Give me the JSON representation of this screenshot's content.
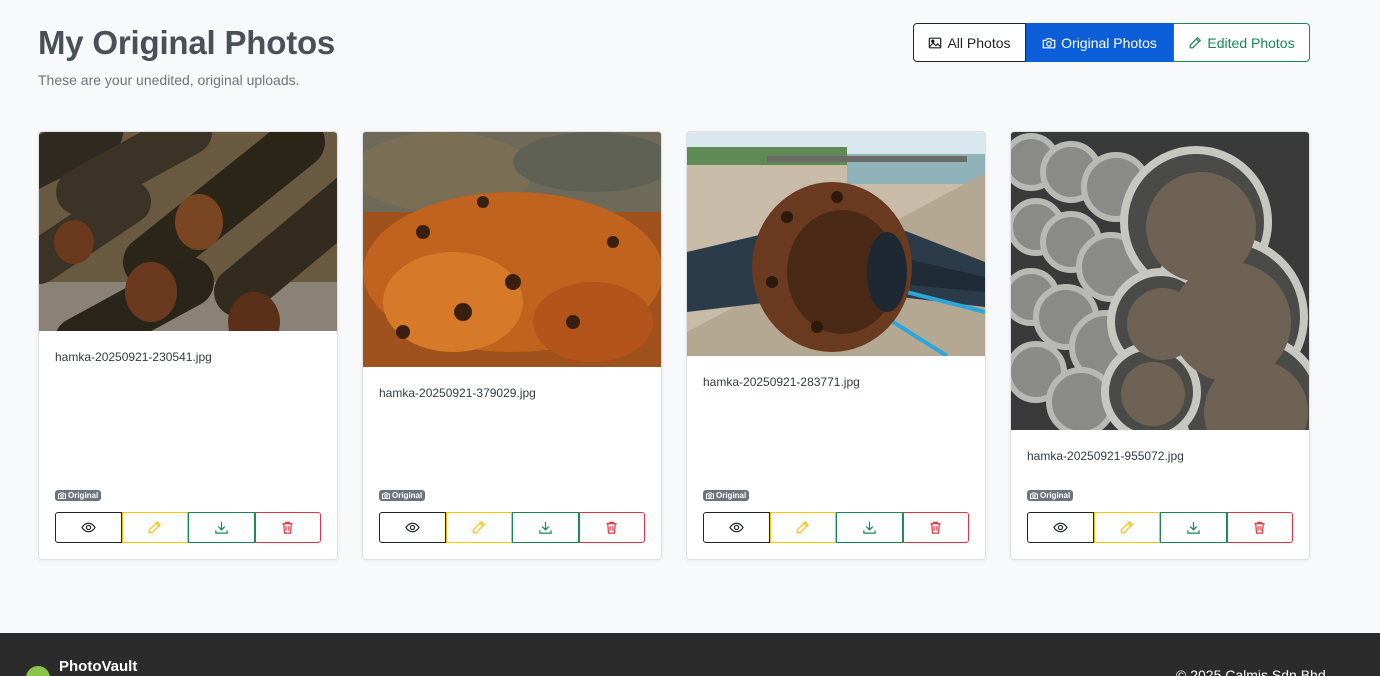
{
  "header": {
    "title": "My Original Photos",
    "subtitle": "These are your unedited, original uploads."
  },
  "filters": {
    "all": "All Photos",
    "original": "Original Photos",
    "edited": "Edited Photos",
    "active": "Original Photos"
  },
  "photos": [
    {
      "filename": "hamka-20250921-230541.jpg",
      "badge": "Original",
      "subject": "rusty steel pipes pile"
    },
    {
      "filename": "hamka-20250921-379029.jpg",
      "badge": "Original",
      "subject": "rusted metal surface"
    },
    {
      "filename": "hamka-20250921-283771.jpg",
      "badge": "Original",
      "subject": "rusty pipe flange by jetty"
    },
    {
      "filename": "hamka-20250921-955072.jpg",
      "badge": "Original",
      "subject": "stacked spiral steel pipes"
    }
  ],
  "actions": [
    "eye-icon",
    "pencil-icon",
    "download-icon",
    "trash-icon"
  ],
  "colors": {
    "primary": "#0b5ed7",
    "success": "#198754",
    "warning": "#ffc107",
    "danger": "#dc3545",
    "badge": "#6c757d",
    "footer": "#2b2b2b"
  },
  "footer": {
    "brand": "PhotoVault",
    "copyright": "© 2025 Calmis Sdn Bhd"
  }
}
